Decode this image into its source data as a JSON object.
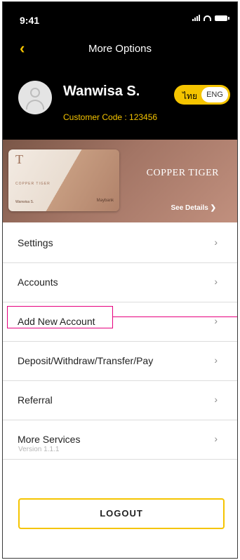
{
  "status": {
    "time": "9:41"
  },
  "header": {
    "title": "More Options",
    "back_icon": "chevron-left-icon"
  },
  "profile": {
    "name": "Wanwisa S.",
    "customer_code": "Customer Code : 123456"
  },
  "language": {
    "thai": "ไทย",
    "english": "ENG",
    "selected": "ENG"
  },
  "banner": {
    "title": "COPPER TIGER",
    "see_details": "See Details ❯",
    "card_mark": "T",
    "card_name": "COPPER TIGER",
    "card_holder": "Wanwisa S.",
    "card_bank": "Maybank"
  },
  "menu": {
    "items": [
      {
        "label": "Settings"
      },
      {
        "label": "Accounts"
      },
      {
        "label": "Add New Account"
      },
      {
        "label": "Deposit/Withdraw/Transfer/Pay"
      },
      {
        "label": "Referral"
      },
      {
        "label": "More Services"
      }
    ],
    "chevron": "›"
  },
  "version": "Version 1.1.1",
  "logout": {
    "label": "LOGOUT"
  },
  "colors": {
    "accent": "#f5c400",
    "highlight": "#e6007e",
    "header_bg": "#000000"
  }
}
